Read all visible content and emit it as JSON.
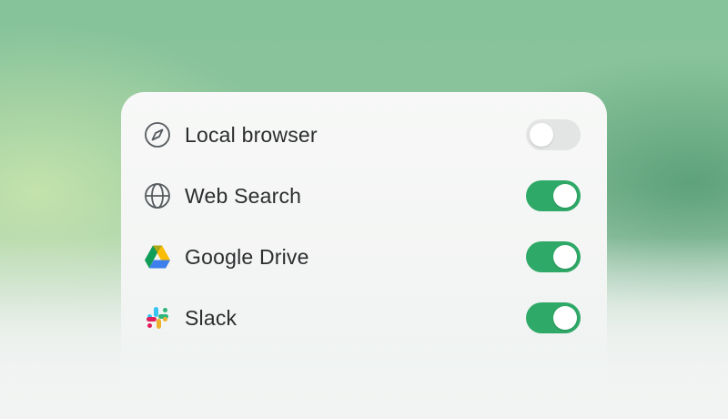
{
  "integrations": [
    {
      "label": "Local browser",
      "icon": "compass-icon",
      "enabled": false
    },
    {
      "label": "Web Search",
      "icon": "globe-icon",
      "enabled": true
    },
    {
      "label": "Google Drive",
      "icon": "google-drive-icon",
      "enabled": true
    },
    {
      "label": "Slack",
      "icon": "slack-icon",
      "enabled": true
    }
  ],
  "colors": {
    "toggle_on": "#2fa968",
    "toggle_off": "#e3e5e4",
    "text": "#2b2d2f"
  }
}
